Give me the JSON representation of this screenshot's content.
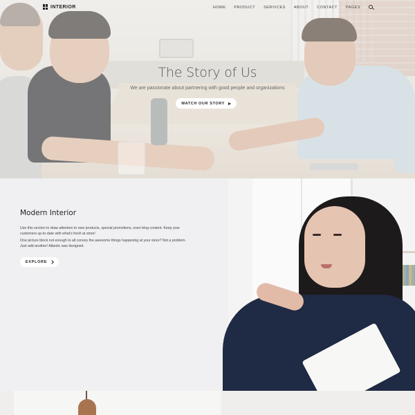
{
  "nav": {
    "logo_text": "INTERIOR",
    "items": [
      "HOME",
      "PRODUCT",
      "SERVICES",
      "ABOUT",
      "CONTACT",
      "PAGES"
    ],
    "search_icon": "search-icon"
  },
  "hero": {
    "title": "The Story of Us",
    "subtitle": "We are passionate about partnering with good people and organizations",
    "button_label": "WATCH OUR STORY",
    "button_icon": "play-icon"
  },
  "feature": {
    "title": "Modern Interior",
    "paragraph_1": "Use this section to draw attention to new products, special promotions, even blog content. Keep your customers up-to-date with what's fresh at store!",
    "paragraph_2": "One picture block not enough to all convey the awesome things happening at your store? Not a problem. Just add another! Atlantic was designed.",
    "button_label": "EXPLORE",
    "button_icon": "chevron-right-icon"
  }
}
